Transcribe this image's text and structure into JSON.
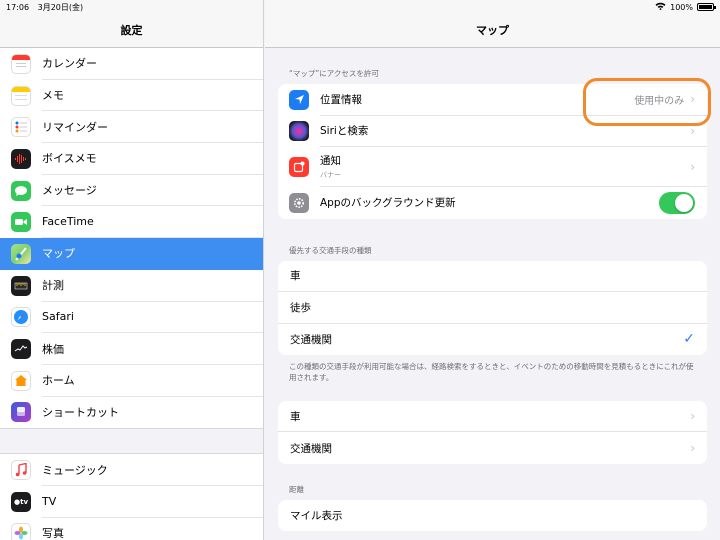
{
  "status": {
    "time": "17:06",
    "date": "3月20日(金)",
    "battery": "100%"
  },
  "sidebar": {
    "title": "設定",
    "items": [
      {
        "label": "カレンダー",
        "icon": "calendar-icon",
        "color": "#ffffff"
      },
      {
        "label": "メモ",
        "icon": "notes-icon",
        "color": "#ffffff"
      },
      {
        "label": "リマインダー",
        "icon": "reminders-icon",
        "color": "#ffffff"
      },
      {
        "label": "ボイスメモ",
        "icon": "voice-memos-icon",
        "color": "#1c1c1e"
      },
      {
        "label": "メッセージ",
        "icon": "messages-icon",
        "color": "#34c759"
      },
      {
        "label": "FaceTime",
        "icon": "facetime-icon",
        "color": "#34c759"
      },
      {
        "label": "マップ",
        "icon": "maps-icon",
        "color": "#7fcf6e"
      },
      {
        "label": "計測",
        "icon": "measure-icon",
        "color": "#1c1c1e"
      },
      {
        "label": "Safari",
        "icon": "safari-icon",
        "color": "#ffffff"
      },
      {
        "label": "株価",
        "icon": "stocks-icon",
        "color": "#1c1c1e"
      },
      {
        "label": "ホーム",
        "icon": "home-icon",
        "color": "#ffffff"
      },
      {
        "label": "ショートカット",
        "icon": "shortcuts-icon",
        "color": "#5b3fd0"
      }
    ],
    "items2": [
      {
        "label": "ミュージック",
        "icon": "music-icon",
        "color": "#ffffff"
      },
      {
        "label": "TV",
        "icon": "tv-icon",
        "color": "#1c1c1e"
      },
      {
        "label": "写真",
        "icon": "photos-icon",
        "color": "#ffffff"
      }
    ]
  },
  "main": {
    "title": "マップ",
    "access_section": "“マップ”にアクセスを許可",
    "access_rows": [
      {
        "label": "位置情報",
        "value": "使用中のみ"
      },
      {
        "label": "Siriと検索"
      },
      {
        "label": "通知",
        "sub": "バナー"
      },
      {
        "label": "Appのバックグラウンド更新"
      }
    ],
    "transport_section": "優先する交通手段の種類",
    "transport_rows": [
      "車",
      "徒歩",
      "交通機関"
    ],
    "transport_note": "この種類の交通手段が利用可能な場合は、経路検索をするときと、イベントのための移動時間を見積もるときにこれが使用されます。",
    "nav_rows": [
      "車",
      "交通機関"
    ],
    "distance_section": "距離",
    "distance_rows": [
      "マイル表示"
    ]
  }
}
